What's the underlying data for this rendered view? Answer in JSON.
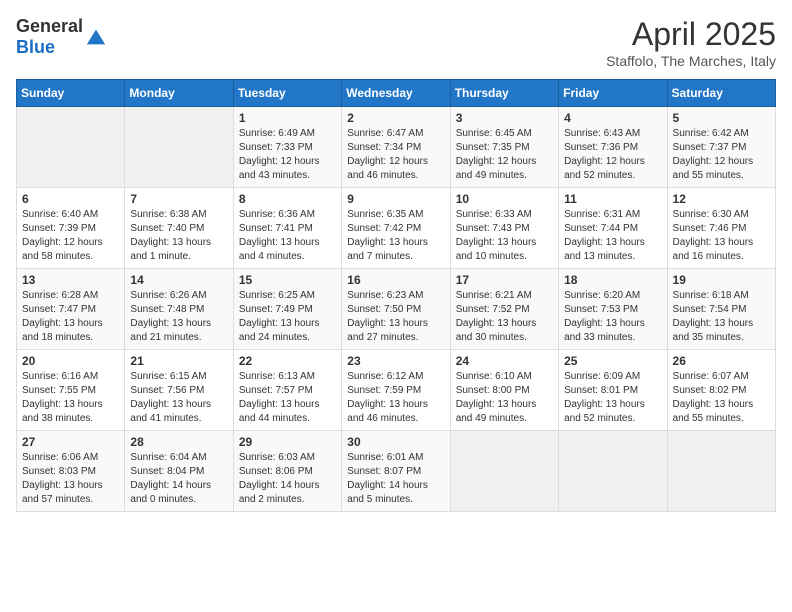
{
  "header": {
    "logo_general": "General",
    "logo_blue": "Blue",
    "title": "April 2025",
    "subtitle": "Staffolo, The Marches, Italy"
  },
  "days_of_week": [
    "Sunday",
    "Monday",
    "Tuesday",
    "Wednesday",
    "Thursday",
    "Friday",
    "Saturday"
  ],
  "weeks": [
    [
      {
        "num": "",
        "info": ""
      },
      {
        "num": "",
        "info": ""
      },
      {
        "num": "1",
        "info": "Sunrise: 6:49 AM\nSunset: 7:33 PM\nDaylight: 12 hours and 43 minutes."
      },
      {
        "num": "2",
        "info": "Sunrise: 6:47 AM\nSunset: 7:34 PM\nDaylight: 12 hours and 46 minutes."
      },
      {
        "num": "3",
        "info": "Sunrise: 6:45 AM\nSunset: 7:35 PM\nDaylight: 12 hours and 49 minutes."
      },
      {
        "num": "4",
        "info": "Sunrise: 6:43 AM\nSunset: 7:36 PM\nDaylight: 12 hours and 52 minutes."
      },
      {
        "num": "5",
        "info": "Sunrise: 6:42 AM\nSunset: 7:37 PM\nDaylight: 12 hours and 55 minutes."
      }
    ],
    [
      {
        "num": "6",
        "info": "Sunrise: 6:40 AM\nSunset: 7:39 PM\nDaylight: 12 hours and 58 minutes."
      },
      {
        "num": "7",
        "info": "Sunrise: 6:38 AM\nSunset: 7:40 PM\nDaylight: 13 hours and 1 minute."
      },
      {
        "num": "8",
        "info": "Sunrise: 6:36 AM\nSunset: 7:41 PM\nDaylight: 13 hours and 4 minutes."
      },
      {
        "num": "9",
        "info": "Sunrise: 6:35 AM\nSunset: 7:42 PM\nDaylight: 13 hours and 7 minutes."
      },
      {
        "num": "10",
        "info": "Sunrise: 6:33 AM\nSunset: 7:43 PM\nDaylight: 13 hours and 10 minutes."
      },
      {
        "num": "11",
        "info": "Sunrise: 6:31 AM\nSunset: 7:44 PM\nDaylight: 13 hours and 13 minutes."
      },
      {
        "num": "12",
        "info": "Sunrise: 6:30 AM\nSunset: 7:46 PM\nDaylight: 13 hours and 16 minutes."
      }
    ],
    [
      {
        "num": "13",
        "info": "Sunrise: 6:28 AM\nSunset: 7:47 PM\nDaylight: 13 hours and 18 minutes."
      },
      {
        "num": "14",
        "info": "Sunrise: 6:26 AM\nSunset: 7:48 PM\nDaylight: 13 hours and 21 minutes."
      },
      {
        "num": "15",
        "info": "Sunrise: 6:25 AM\nSunset: 7:49 PM\nDaylight: 13 hours and 24 minutes."
      },
      {
        "num": "16",
        "info": "Sunrise: 6:23 AM\nSunset: 7:50 PM\nDaylight: 13 hours and 27 minutes."
      },
      {
        "num": "17",
        "info": "Sunrise: 6:21 AM\nSunset: 7:52 PM\nDaylight: 13 hours and 30 minutes."
      },
      {
        "num": "18",
        "info": "Sunrise: 6:20 AM\nSunset: 7:53 PM\nDaylight: 13 hours and 33 minutes."
      },
      {
        "num": "19",
        "info": "Sunrise: 6:18 AM\nSunset: 7:54 PM\nDaylight: 13 hours and 35 minutes."
      }
    ],
    [
      {
        "num": "20",
        "info": "Sunrise: 6:16 AM\nSunset: 7:55 PM\nDaylight: 13 hours and 38 minutes."
      },
      {
        "num": "21",
        "info": "Sunrise: 6:15 AM\nSunset: 7:56 PM\nDaylight: 13 hours and 41 minutes."
      },
      {
        "num": "22",
        "info": "Sunrise: 6:13 AM\nSunset: 7:57 PM\nDaylight: 13 hours and 44 minutes."
      },
      {
        "num": "23",
        "info": "Sunrise: 6:12 AM\nSunset: 7:59 PM\nDaylight: 13 hours and 46 minutes."
      },
      {
        "num": "24",
        "info": "Sunrise: 6:10 AM\nSunset: 8:00 PM\nDaylight: 13 hours and 49 minutes."
      },
      {
        "num": "25",
        "info": "Sunrise: 6:09 AM\nSunset: 8:01 PM\nDaylight: 13 hours and 52 minutes."
      },
      {
        "num": "26",
        "info": "Sunrise: 6:07 AM\nSunset: 8:02 PM\nDaylight: 13 hours and 55 minutes."
      }
    ],
    [
      {
        "num": "27",
        "info": "Sunrise: 6:06 AM\nSunset: 8:03 PM\nDaylight: 13 hours and 57 minutes."
      },
      {
        "num": "28",
        "info": "Sunrise: 6:04 AM\nSunset: 8:04 PM\nDaylight: 14 hours and 0 minutes."
      },
      {
        "num": "29",
        "info": "Sunrise: 6:03 AM\nSunset: 8:06 PM\nDaylight: 14 hours and 2 minutes."
      },
      {
        "num": "30",
        "info": "Sunrise: 6:01 AM\nSunset: 8:07 PM\nDaylight: 14 hours and 5 minutes."
      },
      {
        "num": "",
        "info": ""
      },
      {
        "num": "",
        "info": ""
      },
      {
        "num": "",
        "info": ""
      }
    ]
  ]
}
